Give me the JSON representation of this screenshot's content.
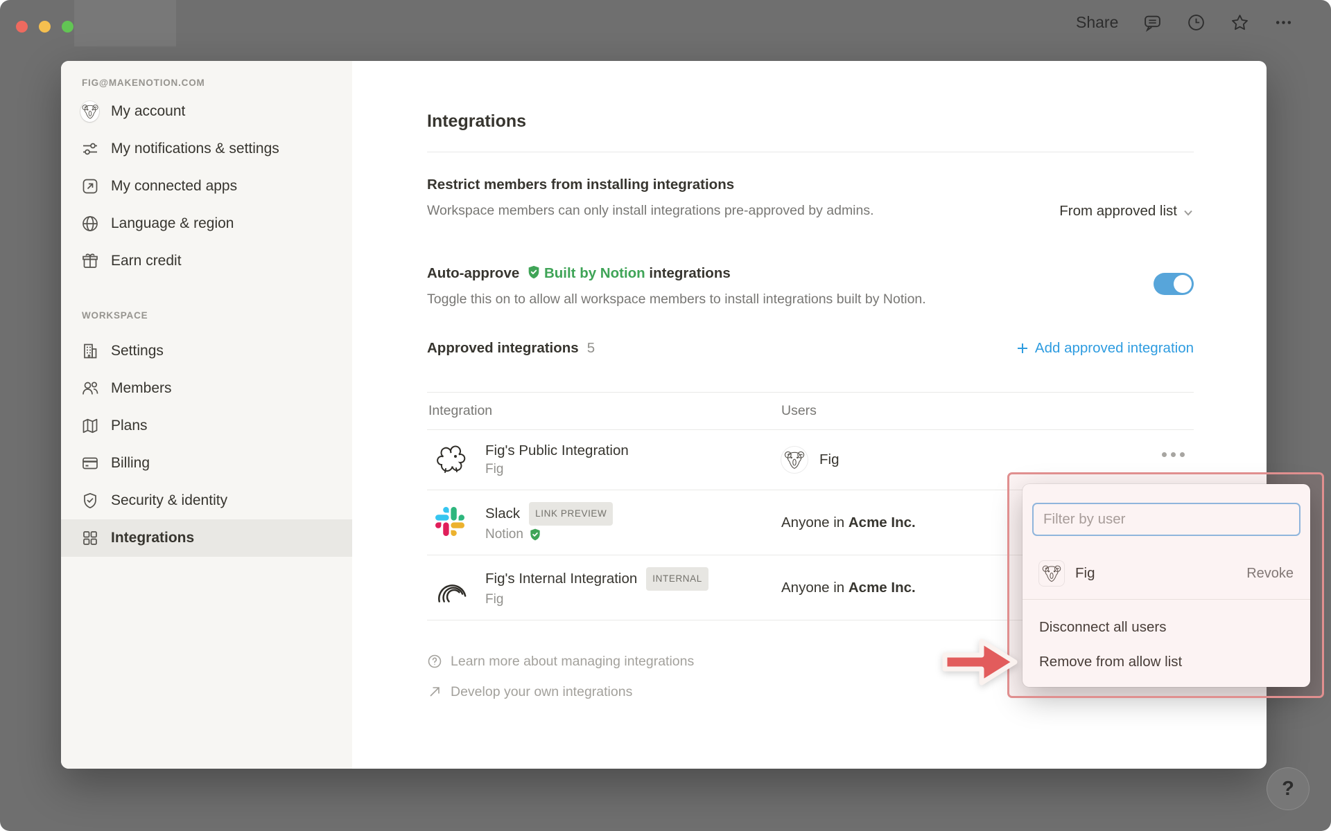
{
  "titlebar": {
    "share_label": "Share"
  },
  "sidebar": {
    "account_email": "FIG@MAKENOTION.COM",
    "account_items": [
      {
        "label": "My account",
        "icon": "fig-avatar"
      },
      {
        "label": "My notifications & settings",
        "icon": "sliders-icon"
      },
      {
        "label": "My connected apps",
        "icon": "connected-apps-icon"
      },
      {
        "label": "Language & region",
        "icon": "globe-icon"
      },
      {
        "label": "Earn credit",
        "icon": "gift-icon"
      }
    ],
    "workspace_label": "WORKSPACE",
    "workspace_items": [
      {
        "label": "Settings",
        "icon": "building-icon"
      },
      {
        "label": "Members",
        "icon": "members-icon"
      },
      {
        "label": "Plans",
        "icon": "map-icon"
      },
      {
        "label": "Billing",
        "icon": "credit-card-icon"
      },
      {
        "label": "Security & identity",
        "icon": "shield-icon"
      },
      {
        "label": "Integrations",
        "icon": "grid-icon",
        "selected": true
      }
    ]
  },
  "main": {
    "title": "Integrations",
    "restrict": {
      "heading": "Restrict members from installing integrations",
      "description": "Workspace members can only install integrations pre-approved by admins.",
      "dropdown_value": "From approved list"
    },
    "auto_approve": {
      "heading_prefix": "Auto-approve",
      "badge": "Built by Notion",
      "heading_suffix": "integrations",
      "description": "Toggle this on to allow all workspace members to install integrations built by Notion.",
      "toggle_state": "on"
    },
    "approved": {
      "heading": "Approved integrations",
      "count": "5",
      "add_label": "Add approved integration"
    },
    "table": {
      "columns": {
        "integration": "Integration",
        "users": "Users"
      },
      "rows": [
        {
          "name": "Fig's Public Integration",
          "badge": "",
          "owner": "Fig",
          "user_name": "Fig"
        },
        {
          "name": "Slack",
          "badge": "LINK PREVIEW",
          "owner": "Notion",
          "users_prefix": "Anyone in ",
          "users_org": "Acme Inc."
        },
        {
          "name": "Fig's Internal Integration",
          "badge": "INTERNAL",
          "owner": "Fig",
          "users_prefix": "Anyone in ",
          "users_org": "Acme Inc."
        }
      ]
    },
    "footer_links": [
      {
        "label": "Learn more about managing integrations",
        "icon": "help-circle-icon"
      },
      {
        "label": "Develop your own integrations",
        "icon": "external-link-icon"
      }
    ]
  },
  "popup": {
    "filter_placeholder": "Filter by user",
    "user": {
      "name": "Fig",
      "action": "Revoke"
    },
    "menu_items": [
      "Disconnect all users",
      "Remove from allow list"
    ]
  },
  "help_label": "?",
  "colors": {
    "backdrop": "#6f6f6f",
    "sidebar_bg": "#f7f6f3",
    "selected_bg": "#e9e8e4",
    "accent_blue": "#2e9ce0",
    "toggle_blue": "#57a5da",
    "notion_green": "#3fa457",
    "annotation_red": "#e25c5c",
    "annotation_border": "#e08f8f"
  }
}
